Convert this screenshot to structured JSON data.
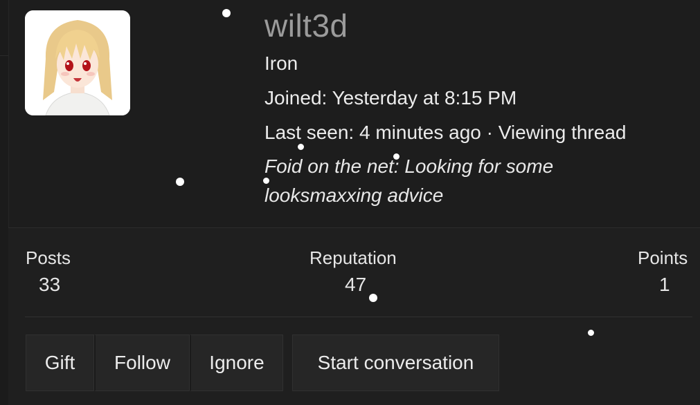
{
  "profile": {
    "username": "wilt3d",
    "rank": "Iron",
    "joined": "Joined: Yesterday at 8:15 PM",
    "last_seen": "Last seen: 4 minutes ago · Viewing thread",
    "status_line": "Foid on the net: Looking for some looksmaxxing advice"
  },
  "stats": {
    "posts_label": "Posts",
    "posts_value": "33",
    "reputation_label": "Reputation",
    "reputation_value": "47",
    "points_label": "Points",
    "points_value": "1"
  },
  "actions": {
    "gift": "Gift",
    "follow": "Follow",
    "ignore": "Ignore",
    "start_conversation": "Start conversation"
  },
  "colors": {
    "background": "#1d1d1d",
    "username": "#9b9b9b",
    "text": "#e6e6e6",
    "button": "#262626"
  }
}
